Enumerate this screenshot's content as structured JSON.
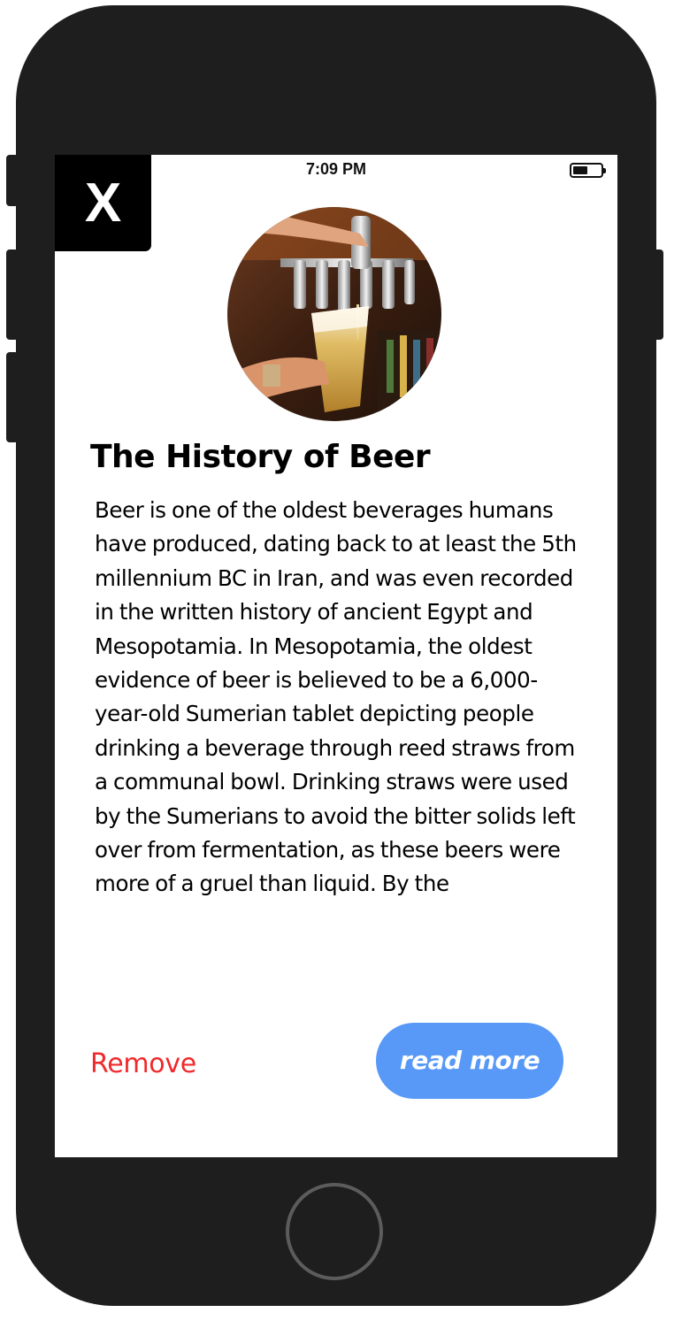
{
  "status_bar": {
    "time": "7:09 PM",
    "battery_level": 0.6
  },
  "close_button": {
    "label": "X"
  },
  "hero_image": {
    "description_icon": "beer-tap-photo"
  },
  "article": {
    "title": "The History of Beer",
    "body": "Beer is one of the oldest beverages humans have produced, dating back to at least the 5th millennium BC in Iran, and was even recorded in the written history of ancient Egypt and Mesopotamia. In Mesopotamia, the oldest evidence of beer is believed to be a 6,000-year-old Sumerian tablet depicting people drinking a beverage through reed straws from a communal bowl. Drinking straws were used by the Sumerians to avoid the bitter solids left over from fermentation, as these beers were more of a gruel than liquid. By the"
  },
  "actions": {
    "remove_label": "Remove",
    "read_more_label": "read more"
  },
  "colors": {
    "remove": "#f0292c",
    "read_more_bg": "#5899f7",
    "device_frame": "#1e1e1e",
    "close_bg": "#000000"
  }
}
